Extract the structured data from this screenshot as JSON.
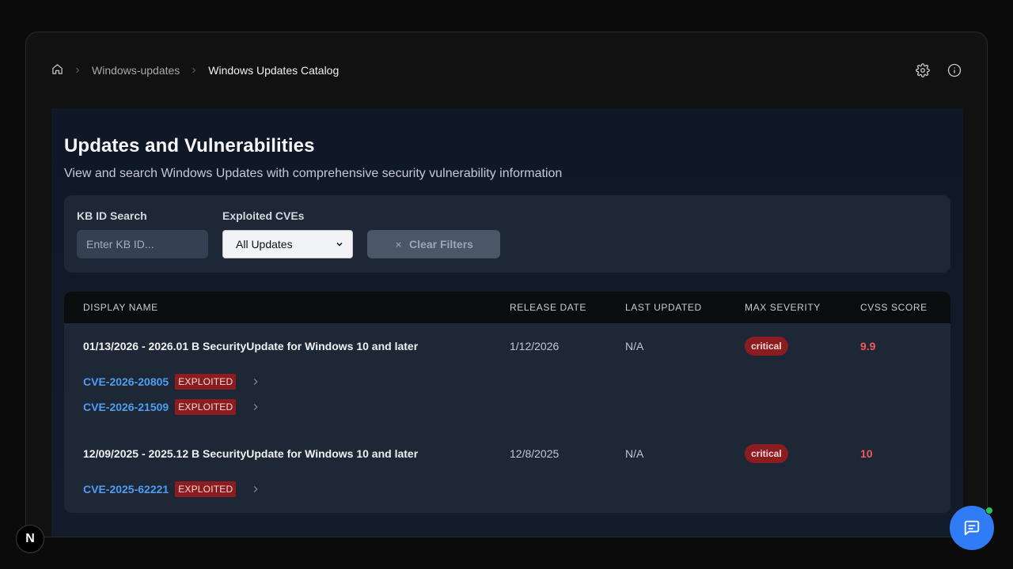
{
  "breadcrumb": {
    "home_icon": "home-icon",
    "items": [
      "Windows-updates",
      "Windows Updates Catalog"
    ]
  },
  "top_actions": {
    "settings_icon": "gear-icon",
    "info_icon": "info-icon"
  },
  "page": {
    "title": "Updates and Vulnerabilities",
    "subtitle": "View and search Windows Updates with comprehensive security vulnerability information"
  },
  "filters": {
    "kb_label": "KB ID Search",
    "kb_placeholder": "Enter KB ID...",
    "kb_value": "",
    "cve_label": "Exploited CVEs",
    "cve_selected": "All Updates",
    "clear_label": "Clear Filters"
  },
  "table": {
    "headers": [
      "DISPLAY NAME",
      "RELEASE DATE",
      "LAST UPDATED",
      "MAX SEVERITY",
      "CVSS SCORE"
    ],
    "rows": [
      {
        "name": "01/13/2026 - 2026.01 B SecurityUpdate for Windows 10 and later",
        "release": "1/12/2026",
        "updated": "N/A",
        "severity": "critical",
        "cvss": "9.9",
        "cves": [
          {
            "id": "CVE-2026-20805",
            "tag": "EXPLOITED"
          },
          {
            "id": "CVE-2026-21509",
            "tag": "EXPLOITED"
          }
        ]
      },
      {
        "name": "12/09/2025 - 2025.12 B SecurityUpdate for Windows 10 and later",
        "release": "12/8/2025",
        "updated": "N/A",
        "severity": "critical",
        "cvss": "10",
        "cves": [
          {
            "id": "CVE-2025-62221",
            "tag": "EXPLOITED"
          }
        ]
      }
    ]
  },
  "floating": {
    "dev_badge": "N",
    "chat_icon": "chat-icon"
  },
  "colors": {
    "accent": "#2f7cf6",
    "critical": "#8b1c20",
    "cvss": "#ef5b5b",
    "link": "#4f9ef0"
  }
}
